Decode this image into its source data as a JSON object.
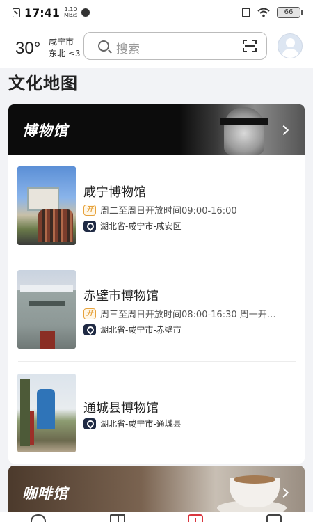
{
  "status_bar": {
    "time": "17:41",
    "net_speed_value": "1.10",
    "net_speed_unit": "MB/s",
    "battery": "66"
  },
  "header": {
    "temperature": "30°",
    "city": "咸宁市",
    "wind": "东北 ≤3",
    "search_placeholder": "搜索"
  },
  "section_title": "文化地图",
  "museum_card": {
    "title": "博物馆",
    "items": [
      {
        "name": "咸宁博物馆",
        "hours": "周二至周日开放时间09:00-16:00",
        "address": "湖北省-咸宁市-咸安区"
      },
      {
        "name": "赤壁市博物馆",
        "hours": "周三至周日开放时间08:00-16:30 周一开…",
        "address": "湖北省-咸宁市-赤壁市"
      },
      {
        "name": "通城县博物馆",
        "address": "湖北省-咸宁市-通城县"
      }
    ],
    "open_badge": "开"
  },
  "cafe_card": {
    "title": "咖啡馆"
  },
  "icons": [
    "search-icon",
    "scan-icon",
    "avatar-icon",
    "chevron-right-icon",
    "open-hours-icon",
    "location-pin-icon",
    "home-icon",
    "guide-icon",
    "add-icon",
    "mine-icon"
  ]
}
